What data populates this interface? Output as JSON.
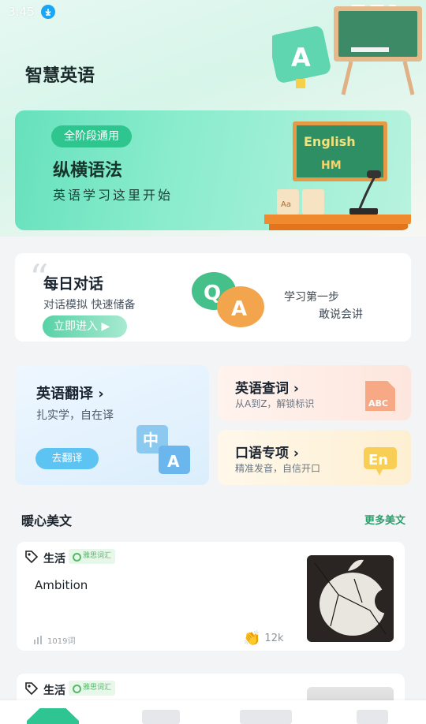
{
  "status_bar": {
    "time": "3:45"
  },
  "app": {
    "title": "智慧英语"
  },
  "banner": {
    "tag": "全阶段通用",
    "title": "纵横语法",
    "subtitle": "英语学习这里开始",
    "board_line1": "English",
    "board_line2": "HM"
  },
  "daily_dialog": {
    "title": "每日对话",
    "subtitle": "对话模拟  快速储备",
    "button": "立即进入",
    "right_line1": "学习第一步",
    "right_line2": "敢说会讲"
  },
  "translate": {
    "title": "英语翻译",
    "subtitle": "扎实学，自在译",
    "button": "去翻译"
  },
  "lookup": {
    "title": "英语查词",
    "subtitle": "从A到Z，解锁标识",
    "icon_text": "ABC"
  },
  "speaking": {
    "title": "口语专项",
    "subtitle": "精准发音，自信开口",
    "icon_text": "En"
  },
  "section": {
    "title": "暖心美文",
    "more": "更多美文"
  },
  "articles": [
    {
      "tag": "生活",
      "level": "雅思词汇",
      "title": "Ambition",
      "words": "1019词",
      "likes": "12k"
    },
    {
      "tag": "生活",
      "level": "雅思词汇"
    }
  ],
  "colors": {
    "accent": "#2fc592",
    "banner_bg": "#66e1bb",
    "translate_button": "#5cc3f3",
    "more_link": "#2e9d6e"
  }
}
